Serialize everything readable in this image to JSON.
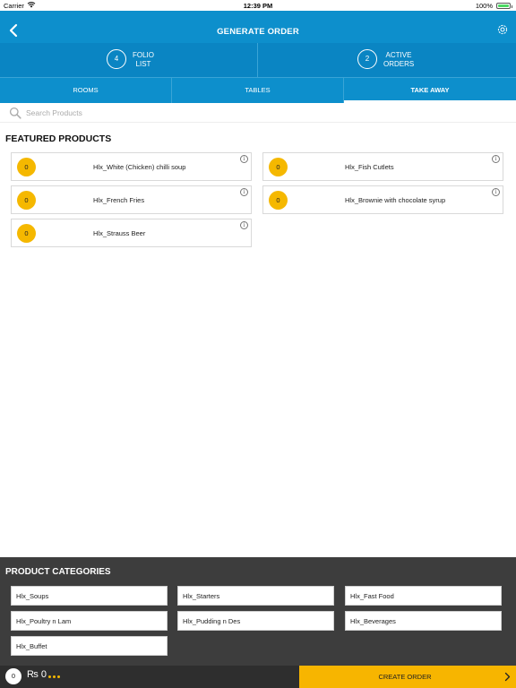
{
  "status_bar": {
    "carrier": "Carrier",
    "time": "12:39 PM",
    "battery": "100%"
  },
  "header": {
    "title": "GENERATE ORDER"
  },
  "folio": {
    "folio_count": "4",
    "folio_label_1": "FOLIO",
    "folio_label_2": "LIST",
    "active_count": "2",
    "active_label_1": "ACTIVE",
    "active_label_2": "ORDERS"
  },
  "tabs": [
    {
      "label": "ROOMS"
    },
    {
      "label": "TABLES"
    },
    {
      "label": "TAKE AWAY",
      "selected": true
    }
  ],
  "search": {
    "placeholder": "Search Products",
    "value": ""
  },
  "featured": {
    "title": "FEATURED PRODUCTS",
    "products": [
      {
        "qty": "0",
        "name": "Hlx_White (Chicken) chilli soup"
      },
      {
        "qty": "0",
        "name": "Hlx_Fish Cutlets"
      },
      {
        "qty": "0",
        "name": "Hlx_French Fries"
      },
      {
        "qty": "0",
        "name": "Hlx_Brownie with chocolate syrup"
      },
      {
        "qty": "0",
        "name": "Hlx_Strauss Beer"
      }
    ],
    "info_glyph": "i"
  },
  "categories": {
    "title": "PRODUCT CATEGORIES",
    "items": [
      "Hlx_Soups",
      "Hlx_Starters",
      "Hlx_Fast Food",
      "Hlx_Poultry n Lam",
      "Hlx_Pudding n Des",
      "Hlx_Beverages",
      "Hlx_Buffet"
    ]
  },
  "footer": {
    "cart_count": "0",
    "amount": "₨ 0",
    "create_label": "CREATE ORDER"
  },
  "colors": {
    "primary": "#0d8fcc",
    "accent": "#f5b800",
    "dark": "#3d3d3d"
  }
}
